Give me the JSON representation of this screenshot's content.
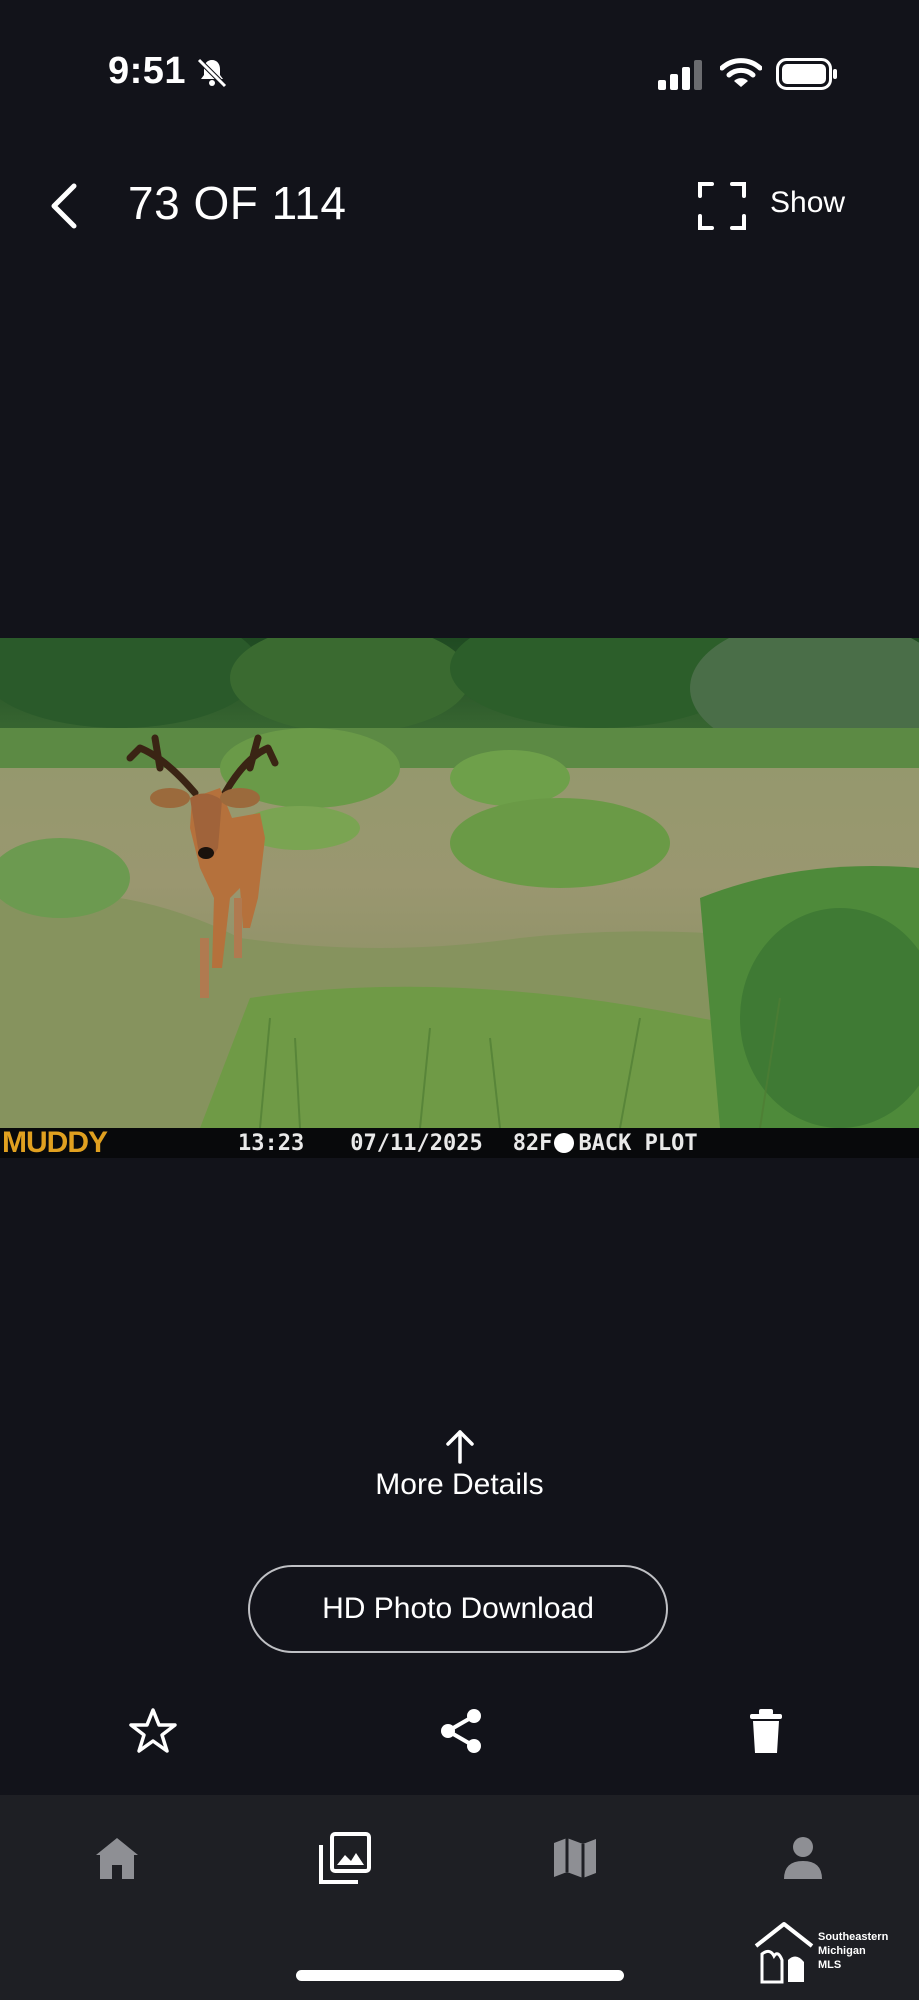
{
  "status_bar": {
    "time": "9:51"
  },
  "header": {
    "counter": "73 OF 114",
    "show_label": "Show"
  },
  "photo": {
    "brand": "MUDDY",
    "time": "13:23",
    "date": "07/11/2025",
    "temperature": "82F",
    "location": "BACK PLOT"
  },
  "details": {
    "more_label": "More Details"
  },
  "actions": {
    "hd_download_label": "HD Photo Download"
  },
  "watermark": {
    "line1": "Southeastern",
    "line2": "Michigan",
    "line3": "MLS"
  }
}
